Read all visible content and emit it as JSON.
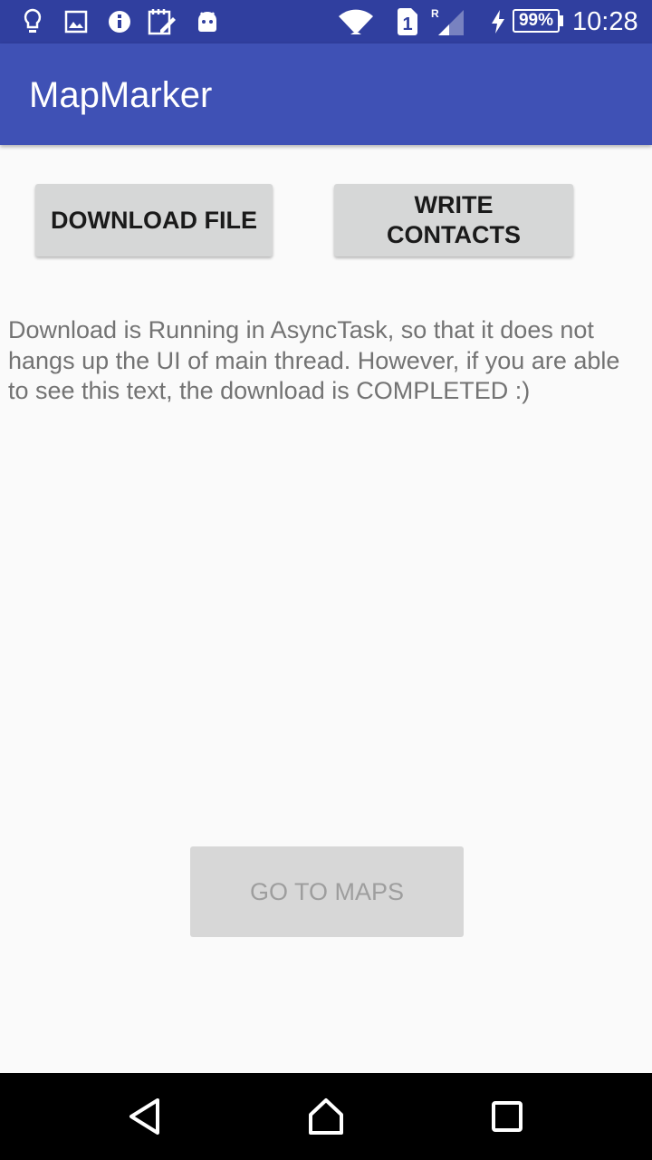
{
  "status_bar": {
    "battery": "99%",
    "time": "10:28",
    "sim_slot": "1",
    "roaming": "R",
    "icons": [
      "lightbulb-icon",
      "image-icon",
      "info-icon",
      "notes-icon",
      "android-icon",
      "wifi-icon",
      "sim-icon",
      "signal-icon",
      "charging-icon",
      "battery-icon"
    ]
  },
  "app_bar": {
    "title": "MapMarker"
  },
  "buttons": {
    "download": "DOWNLOAD FILE",
    "write_contacts": "WRITE\nCONTACTS",
    "go_to_maps": "GO TO MAPS"
  },
  "message": "Download is Running in AsyncTask, so that it does not hangs up the UI of main thread. However, if you are able to see this text, the download is COMPLETED :)",
  "nav_bar": {
    "icons": [
      "back-icon",
      "home-icon",
      "recents-icon"
    ]
  },
  "colors": {
    "status_bar": "#303f9f",
    "app_bar": "#3f51b5",
    "background": "#fafafa",
    "button": "#d6d7d7",
    "text": "#737373"
  }
}
